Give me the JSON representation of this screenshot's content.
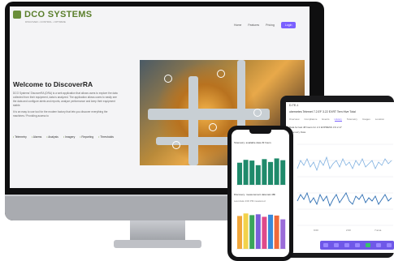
{
  "brand": {
    "name": "DCO SYSTEMS",
    "tagline": "DISCOVER • CONTROL • OPTIMIZE",
    "color": "#5b7f2c"
  },
  "nav": {
    "items": [
      "Home",
      "Features",
      "Pricing"
    ],
    "login": "Login"
  },
  "hero": {
    "title": "Welcome to DiscoverRA",
    "paragraph1": "DCO Systems' DiscoverRA (DRA) is a web application that allows users to explore the data collected from their equipment, data is analyzed. The application allows users to easily see the data and configure alerts and reports, analyze performance and keep their equipment stable.",
    "paragraph2": "It is an easy to use tool for the modern factory that lets you discover everything the machines / Providing access to",
    "features": [
      "Telemetry",
      "Alarms",
      "Analysis",
      "Imagery",
      "Reporting",
      "Thresholds"
    ]
  },
  "tablet": {
    "header": "D-TE-1",
    "title": "ubernetes Telemet 7.2.EF 3.22 EXRT Tem Hive Total",
    "tabs": [
      "Overview",
      "Compliance",
      "Events",
      "History",
      "Telemetry",
      "Images",
      "Location"
    ],
    "active_tab": "History",
    "subtitle": "Data for last 48 hours for 2 2 EXPRESS 3.9 2.17",
    "chart_caption": "Telemetry Data",
    "x_ticks": [
      "9:00",
      "2:00",
      "7:ama"
    ],
    "accent": "#7b61ff"
  },
  "phone": {
    "chart1_title": "Telemetry: available data 29 hours",
    "chart2_title": "Discovery: measurement data last 48h",
    "chart2_sub": "Last data 4:00 PM measured",
    "bars1": [
      0.62,
      0.7,
      0.68,
      0.55,
      0.72,
      0.64,
      0.74,
      0.69
    ],
    "bars2": [
      0.78,
      0.84,
      0.8,
      0.82,
      0.76,
      0.81,
      0.79,
      0.7
    ],
    "bar1_color": "#1f8a6b",
    "bar2_colors": [
      "#f0a63a",
      "#f2d24a",
      "#3aa55a",
      "#7a5fd9",
      "#e04a8a",
      "#3a8ad9",
      "#f06a3a",
      "#9a6bd9"
    ]
  }
}
